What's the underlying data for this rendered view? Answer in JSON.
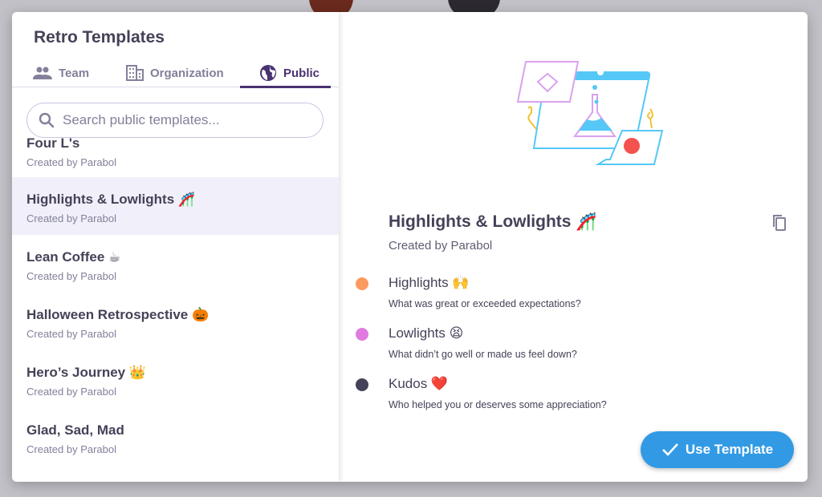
{
  "modal": {
    "title": "Retro Templates"
  },
  "tabs": [
    {
      "label": "Team",
      "icon": "people-icon"
    },
    {
      "label": "Organization",
      "icon": "building-icon"
    },
    {
      "label": "Public",
      "icon": "globe-icon",
      "active": true
    }
  ],
  "search": {
    "placeholder": "Search public templates...",
    "value": ""
  },
  "templates": [
    {
      "name": "Four L's",
      "creator": "Created by Parabol"
    },
    {
      "name": "Highlights & Lowlights 🎢",
      "creator": "Created by Parabol",
      "selected": true
    },
    {
      "name": "Lean Coffee ☕",
      "creator": "Created by Parabol"
    },
    {
      "name": "Halloween Retrospective 🎃",
      "creator": "Created by Parabol"
    },
    {
      "name": "Hero’s Journey 👑",
      "creator": "Created by Parabol"
    },
    {
      "name": "Glad, Sad, Mad",
      "creator": "Created by Parabol"
    }
  ],
  "detail": {
    "title": "Highlights & Lowlights 🎢",
    "creator": "Created by Parabol",
    "prompts": [
      {
        "name": "Highlights 🙌",
        "description": "What was great or exceeded expectations?",
        "color": "#fd9a5f"
      },
      {
        "name": "Lowlights 😫",
        "description": "What didn’t go well or made us feel down?",
        "color": "#e07ae0"
      },
      {
        "name": "Kudos ❤️",
        "description": "Who helped you or deserves some appreciation?",
        "color": "#444258"
      }
    ],
    "use_label": "Use Template"
  }
}
